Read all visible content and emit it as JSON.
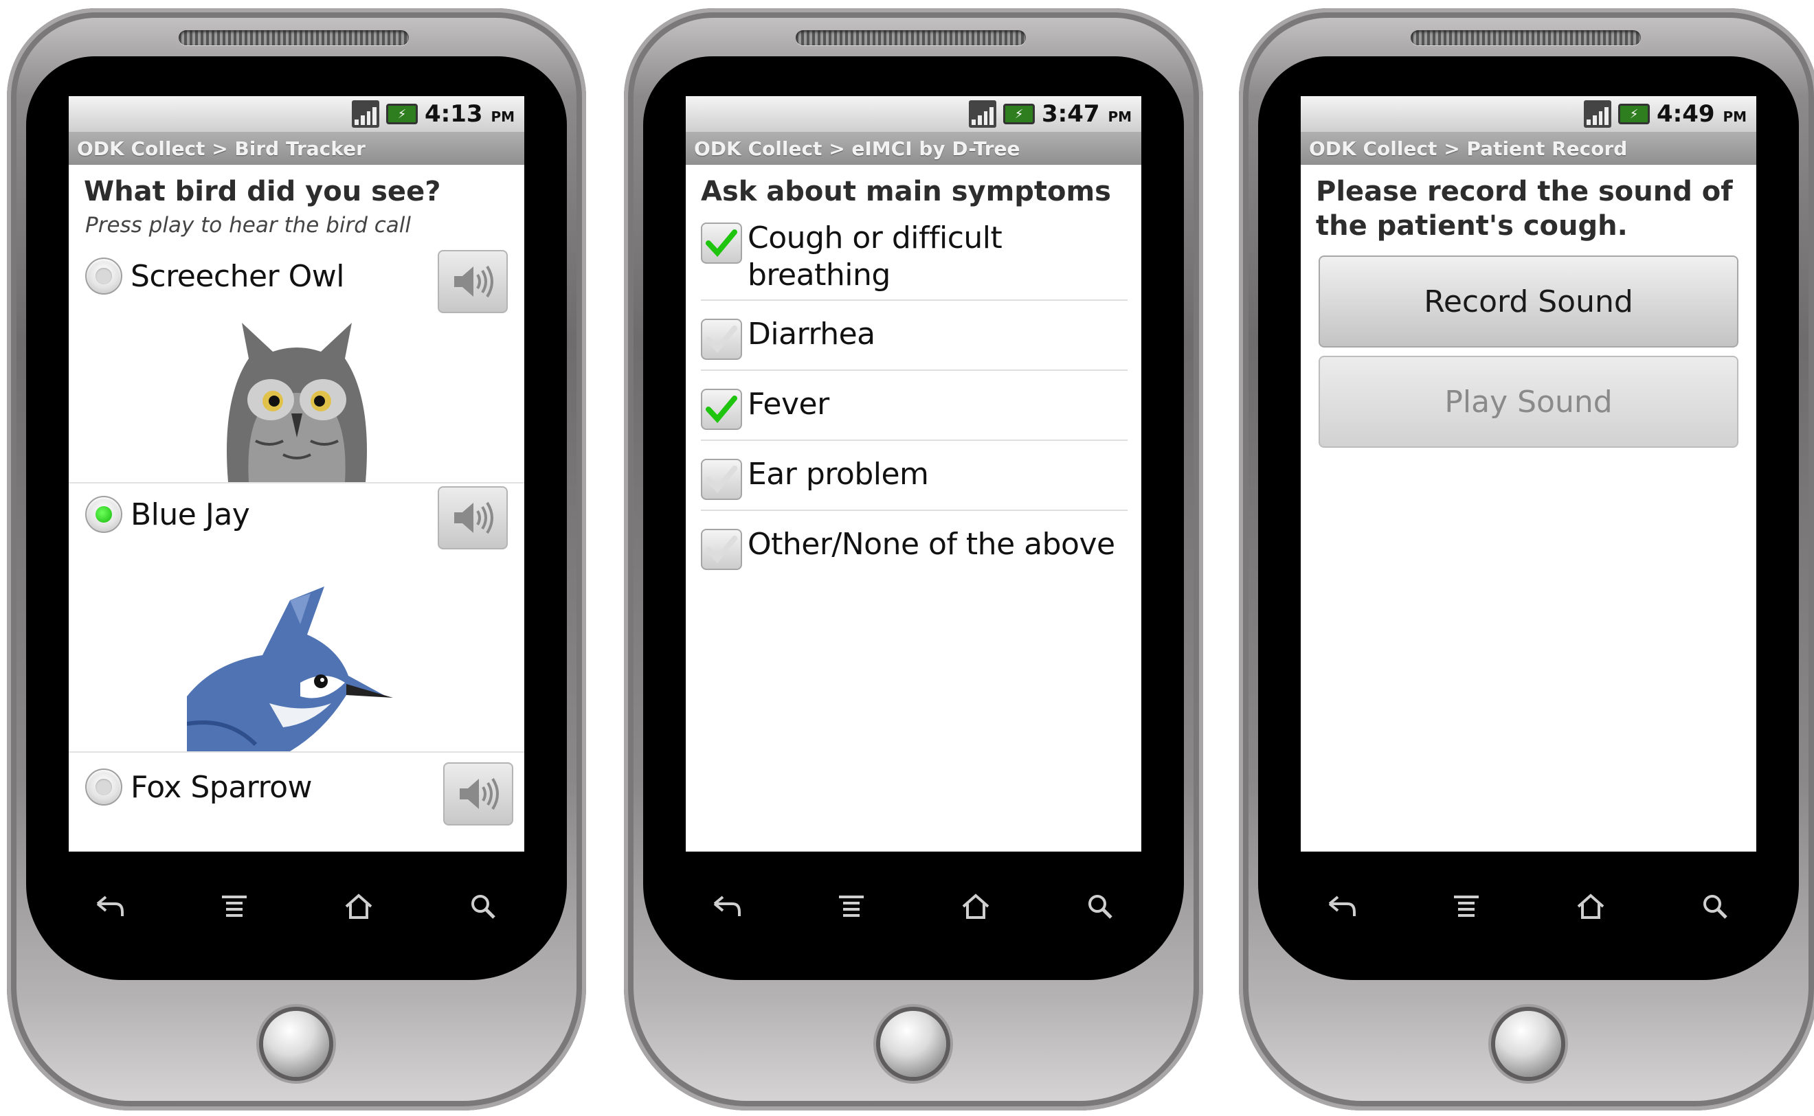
{
  "phones": [
    {
      "status": {
        "time": "4:13",
        "ampm": "PM"
      },
      "title": "ODK Collect > Bird Tracker",
      "question": "What bird did you see?",
      "hint": "Press play to hear the bird call",
      "options": [
        {
          "label": "Screecher Owl",
          "selected": false
        },
        {
          "label": "Blue Jay",
          "selected": true
        },
        {
          "label": "Fox Sparrow",
          "selected": false
        }
      ]
    },
    {
      "status": {
        "time": "3:47",
        "ampm": "PM"
      },
      "title": "ODK Collect > eIMCI by D-Tree",
      "question": "Ask about main symptoms",
      "options": [
        {
          "label": "Cough or difficult breathing",
          "checked": true
        },
        {
          "label": "Diarrhea",
          "checked": false
        },
        {
          "label": "Fever",
          "checked": true
        },
        {
          "label": "Ear problem",
          "checked": false
        },
        {
          "label": "Other/None of the above",
          "checked": false
        }
      ]
    },
    {
      "status": {
        "time": "4:49",
        "ampm": "PM"
      },
      "title": "ODK Collect > Patient Record",
      "question": "Please record the sound of the patient's cough.",
      "buttons": {
        "record": "Record Sound",
        "play": "Play Sound"
      }
    }
  ],
  "icons": {
    "nav": [
      "back-icon",
      "menu-icon",
      "home-icon",
      "search-icon"
    ],
    "status": [
      "signal-icon",
      "battery-icon"
    ],
    "audio": "speaker-icon"
  },
  "colors": {
    "radio_selected": "#16b90a",
    "check_mark": "#1fc40f",
    "title_bar": "#9a9a9a"
  }
}
